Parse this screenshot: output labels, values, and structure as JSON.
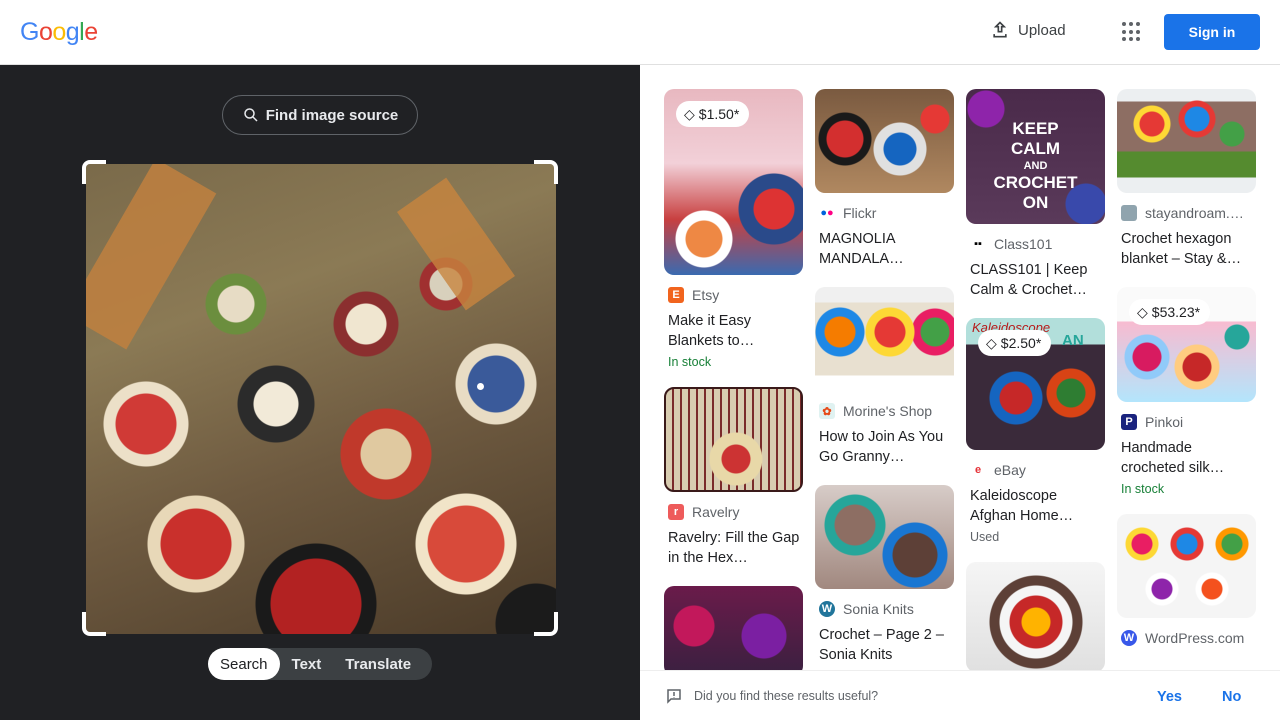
{
  "header": {
    "logo": "Google",
    "upload_label": "Upload",
    "apps_icon": "apps-grid-icon",
    "signin_label": "Sign in",
    "colors": {
      "signin": "#1a73e8"
    }
  },
  "left_panel": {
    "find_source_label": "Find image source",
    "modes": [
      "Search",
      "Text",
      "Translate"
    ],
    "active_mode": "Search"
  },
  "results": {
    "col1": [
      {
        "price": "$1.50*",
        "source": "Etsy",
        "title": "Make it Easy Blankets to…",
        "status": "In stock"
      },
      {
        "source": "Ravelry",
        "title": "Ravelry: Fill the Gap in the Hex…"
      },
      {}
    ],
    "col2": [
      {
        "source": "Flickr",
        "title": "MAGNOLIA MANDALA…"
      },
      {
        "source": "Morine's Shop",
        "title": "How to Join As You Go Granny…"
      },
      {
        "source": "Sonia Knits",
        "title": "Crochet – Page 2 – Sonia Knits"
      }
    ],
    "col3": [
      {
        "source": "Class101",
        "title": "CLASS101 | Keep Calm & Crochet…",
        "thumb_text": [
          "KEEP",
          "CALM",
          "AND",
          "CROCHET",
          "ON"
        ]
      },
      {
        "price": "$2.50*",
        "source": "eBay",
        "title": "Kaleidoscope Afghan Home…",
        "status": "Used",
        "thumb_text": [
          "Kaleidoscope",
          "AN"
        ]
      },
      {}
    ],
    "col4": [
      {
        "source": "stayandroam.…",
        "title": "Crochet hexagon blanket – Stay &…"
      },
      {
        "price": "$53.23*",
        "source": "Pinkoi",
        "title": "Handmade crocheted silk…",
        "status": "In stock"
      },
      {
        "source": "WordPress.com"
      }
    ]
  },
  "feedback": {
    "question": "Did you find these results useful?",
    "yes": "Yes",
    "no": "No"
  }
}
